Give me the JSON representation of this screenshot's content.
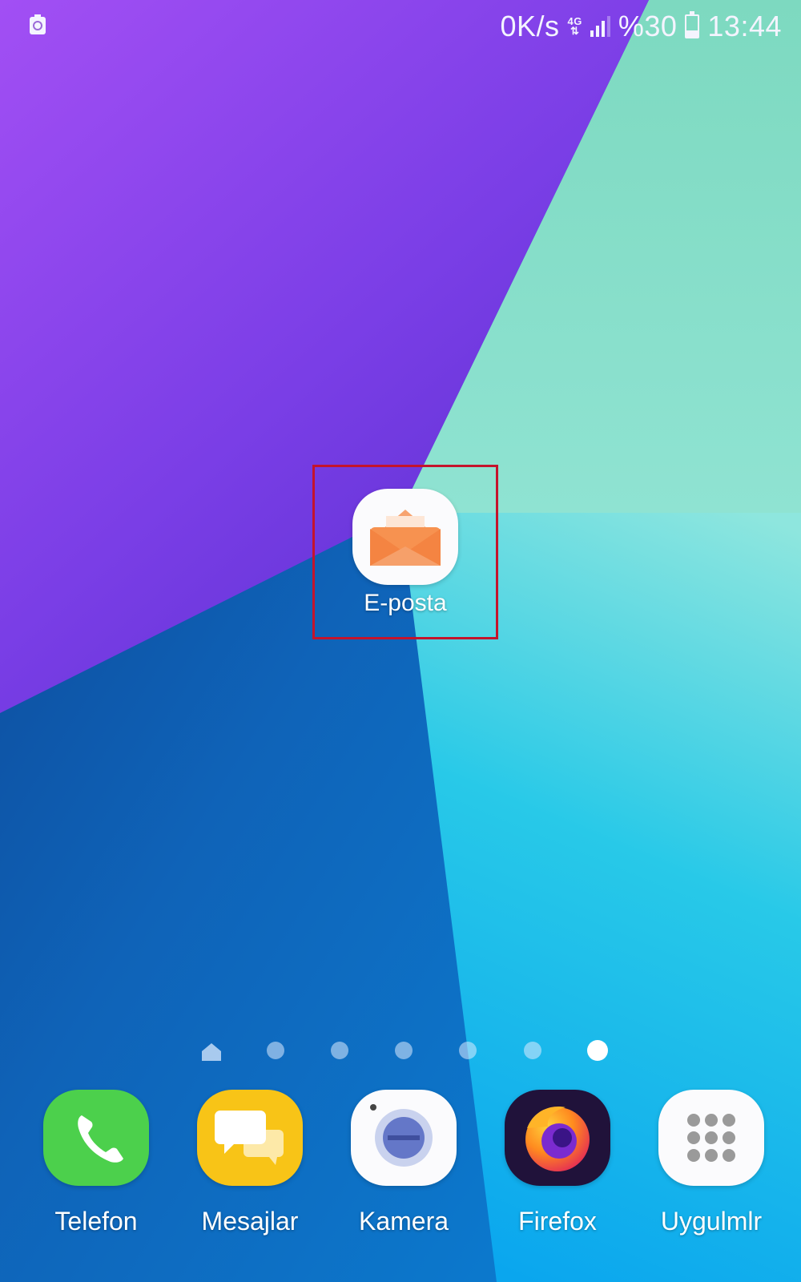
{
  "status_bar": {
    "network_speed": "0K/s",
    "network_type_top": "4G",
    "battery_percent": "%30",
    "battery_level": 0.3,
    "time": "13:44",
    "left_icon": "recycle-notification-icon"
  },
  "home": {
    "shortcut": {
      "label": "E-posta",
      "icon": "email-envelope-icon",
      "highlighted": true
    }
  },
  "page_indicator": {
    "pages": 7,
    "current_page": 7,
    "first_is_home": true
  },
  "dock": [
    {
      "label": "Telefon",
      "icon": "phone-icon",
      "color": "#4cd04c"
    },
    {
      "label": "Mesajlar",
      "icon": "messages-icon",
      "color": "#f8c417"
    },
    {
      "label": "Kamera",
      "icon": "camera-icon",
      "color": "#6477c8"
    },
    {
      "label": "Firefox",
      "icon": "firefox-icon",
      "color": "#20123a"
    },
    {
      "label": "Uygulmlr",
      "icon": "apps-grid-icon",
      "color": "#9a9a9a"
    }
  ],
  "colors": {
    "highlight_box": "#c4142c"
  }
}
